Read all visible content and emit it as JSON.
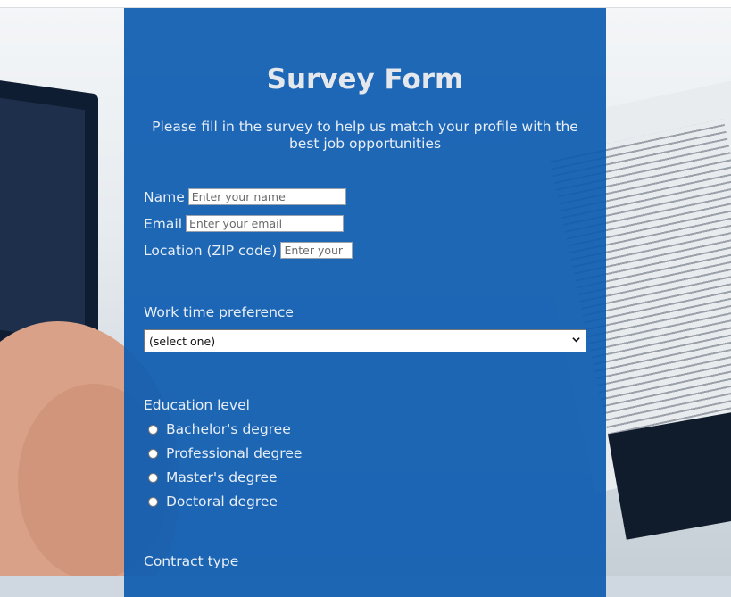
{
  "form": {
    "title": "Survey Form",
    "description": "Please fill in the survey to help us match your profile with the best job opportunities",
    "name": {
      "label": "Name",
      "placeholder": "Enter your name",
      "value": ""
    },
    "email": {
      "label": "Email",
      "placeholder": "Enter your email",
      "value": ""
    },
    "location": {
      "label": "Location (ZIP code)",
      "placeholder": "Enter your",
      "value": ""
    },
    "work_time": {
      "label": "Work time preference",
      "selected": "(select one)"
    },
    "education": {
      "label": "Education level",
      "options": [
        "Bachelor's degree",
        "Professional degree",
        "Master's degree",
        "Doctoral degree"
      ]
    },
    "contract": {
      "label": "Contract type"
    }
  },
  "colors": {
    "card": "#0e5cb0",
    "text": "#e8eef6",
    "title": "#e4e7ec"
  }
}
